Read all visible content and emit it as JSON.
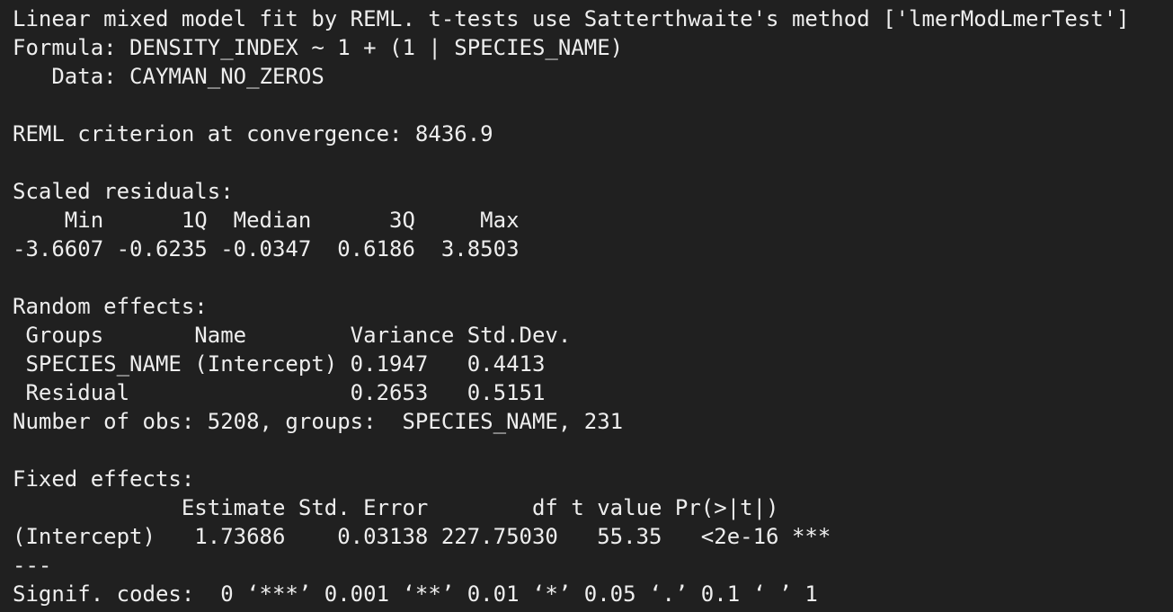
{
  "colors": {
    "background": "#202020",
    "text": "#eeeeee"
  },
  "console": {
    "lines": [
      "Linear mixed model fit by REML. t-tests use Satterthwaite's method ['lmerModLmerTest']",
      "Formula: DENSITY_INDEX ~ 1 + (1 | SPECIES_NAME)",
      "   Data: CAYMAN_NO_ZEROS",
      "",
      "REML criterion at convergence: 8436.9",
      "",
      "Scaled residuals:",
      "    Min      1Q  Median      3Q     Max ",
      "-3.6607 -0.6235 -0.0347  0.6186  3.8503 ",
      "",
      "Random effects:",
      " Groups       Name        Variance Std.Dev.",
      " SPECIES_NAME (Intercept) 0.1947   0.4413  ",
      " Residual                 0.2653   0.5151  ",
      "Number of obs: 5208, groups:  SPECIES_NAME, 231",
      "",
      "Fixed effects:",
      "             Estimate Std. Error        df t value Pr(>|t|)    ",
      "(Intercept)   1.73686    0.03138 227.75030   55.35   <2e-16 ***",
      "---",
      "Signif. codes:  0 ‘***’ 0.001 ‘**’ 0.01 ‘*’ 0.05 ‘.’ 0.1 ‘ ’ 1"
    ]
  }
}
